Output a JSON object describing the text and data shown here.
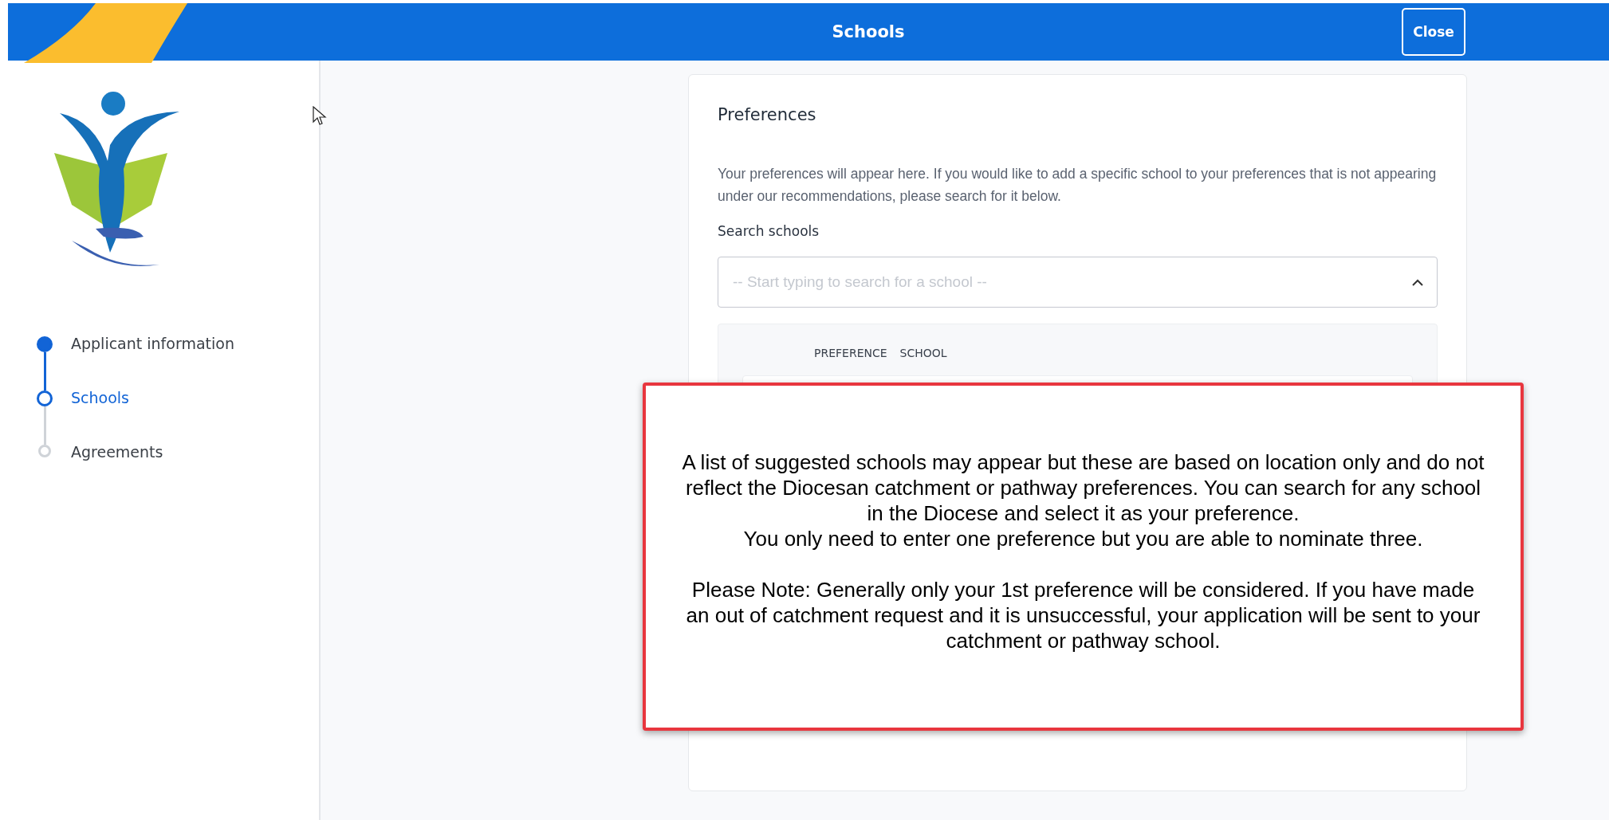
{
  "header": {
    "title": "Schools",
    "close_button": "Close"
  },
  "steps": [
    {
      "label": "Applicant information",
      "completed": true,
      "selected": false
    },
    {
      "label": "Schools",
      "completed": false,
      "selected": true
    },
    {
      "label": "Agreements",
      "completed": false,
      "selected": false
    }
  ],
  "preferences": {
    "title": "Preferences",
    "description": "Your preferences will appear here. If you would like to add a specific school to your preferences that is not appearing under our recommendations, please search for it below.",
    "search_label": "Search schools",
    "search": {
      "placeholder": "-- Start typing to search for a school --"
    },
    "table": {
      "columns": [
        "PREFERENCE",
        "SCHOOL"
      ]
    }
  },
  "notice": {
    "paragraphs": [
      [
        "A list of suggested schools may appear but these are based on location only and do not reflect the Diocesan catchment or pathway preferences. You can search for any school in the Diocese and select it as your preference.",
        "You only need to enter one preference but you are able to nominate three."
      ],
      [
        "Please Note: Generally only your 1st preference will be considered. If you have made an out of catchment request and it is unsuccessful, your application will be sent to your catchment or pathway school."
      ]
    ]
  }
}
